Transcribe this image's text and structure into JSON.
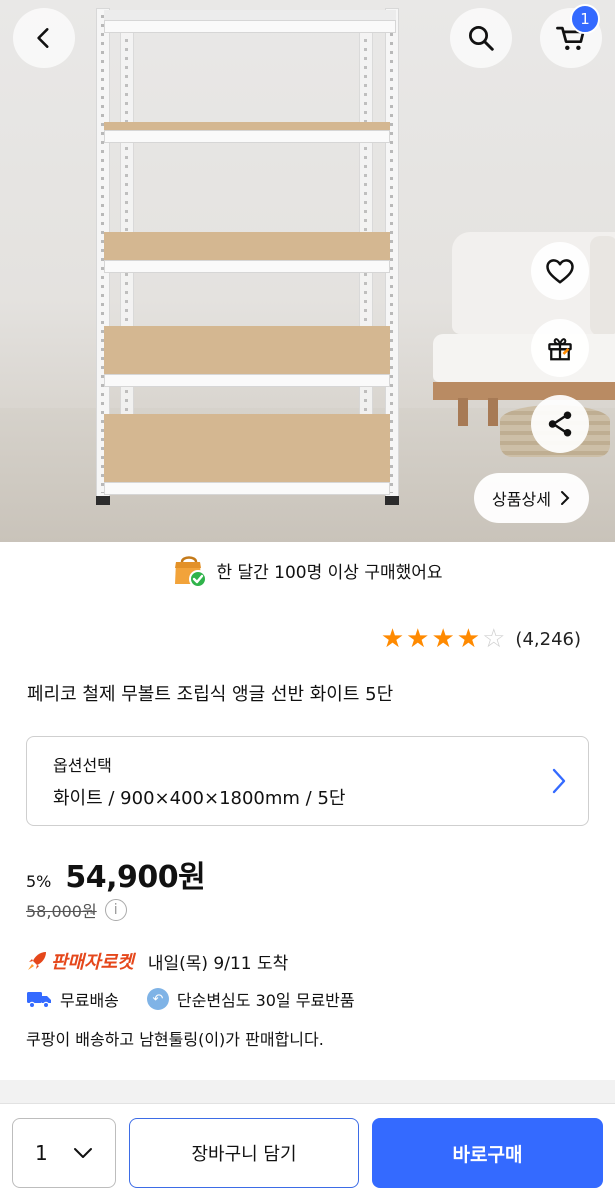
{
  "header": {
    "cart_count": "1"
  },
  "image_actions": {
    "detail_label": "상품상세"
  },
  "social_proof": {
    "text": "한 달간 100명 이상 구매했어요"
  },
  "rating": {
    "stars": 4,
    "max_stars": 5,
    "count_text": "(4,246)"
  },
  "product": {
    "title": "페리코 철제 무볼트 조립식 앵글 선반 화이트 5단"
  },
  "option": {
    "label": "옵션선택",
    "value": "화이트 / 900×400×1800mm / 5단"
  },
  "price": {
    "discount": "5%",
    "sale_price": "54,900원",
    "original_price": "58,000원"
  },
  "delivery": {
    "badge": "판매자로켓",
    "arrival": "내일(목) 9/11 도착",
    "free_shipping": "무료배송",
    "free_return": "단순변심도 30일 무료반품",
    "seller_note": "쿠팡이 배송하고 남현툴링(이)가 판매합니다."
  },
  "bottom_bar": {
    "quantity": "1",
    "add_to_cart": "장바구니 담기",
    "buy_now": "바로구매"
  },
  "colors": {
    "accent": "#346aff",
    "star": "#ff8a00",
    "rocket": "#e5471b"
  }
}
